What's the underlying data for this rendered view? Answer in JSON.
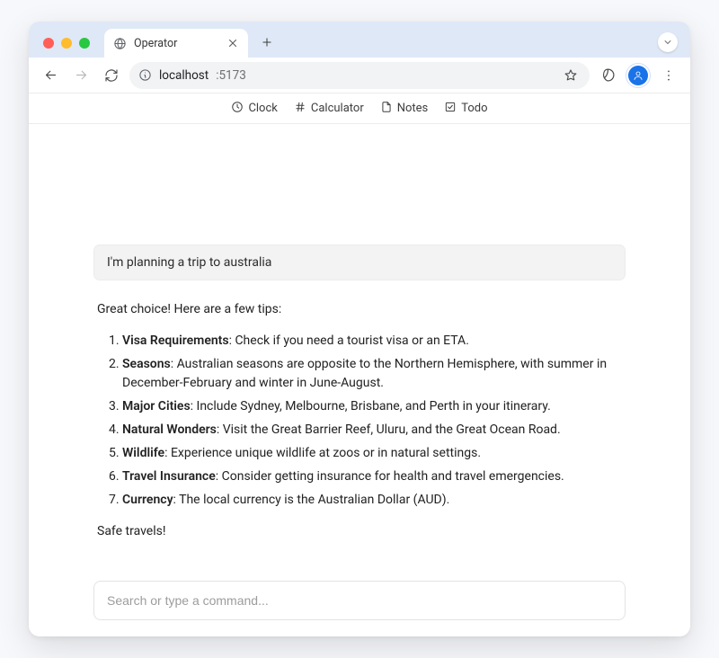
{
  "window": {
    "tab_title": "Operator",
    "url_host": "localhost",
    "url_port": ":5173"
  },
  "app_nav": {
    "items": [
      {
        "label": "Clock",
        "icon": "clock-icon"
      },
      {
        "label": "Calculator",
        "icon": "hash-icon"
      },
      {
        "label": "Notes",
        "icon": "file-icon"
      },
      {
        "label": "Todo",
        "icon": "check-square-icon"
      }
    ]
  },
  "conversation": {
    "user_message": "I'm planning a trip to australia",
    "assistant_intro": "Great choice! Here are a few tips:",
    "tips": [
      {
        "title": "Visa Requirements",
        "body": ": Check if you need a tourist visa or an ETA."
      },
      {
        "title": "Seasons",
        "body": ": Australian seasons are opposite to the Northern Hemisphere, with summer in December-February and winter in June-August."
      },
      {
        "title": "Major Cities",
        "body": ": Include Sydney, Melbourne, Brisbane, and Perth in your itinerary."
      },
      {
        "title": "Natural Wonders",
        "body": ": Visit the Great Barrier Reef, Uluru, and the Great Ocean Road."
      },
      {
        "title": "Wildlife",
        "body": ": Experience unique wildlife at zoos or in natural settings."
      },
      {
        "title": "Travel Insurance",
        "body": ": Consider getting insurance for health and travel emergencies."
      },
      {
        "title": "Currency",
        "body": ": The local currency is the Australian Dollar (AUD)."
      }
    ],
    "assistant_outro": "Safe travels!"
  },
  "command_input": {
    "placeholder": "Search or type a command..."
  }
}
